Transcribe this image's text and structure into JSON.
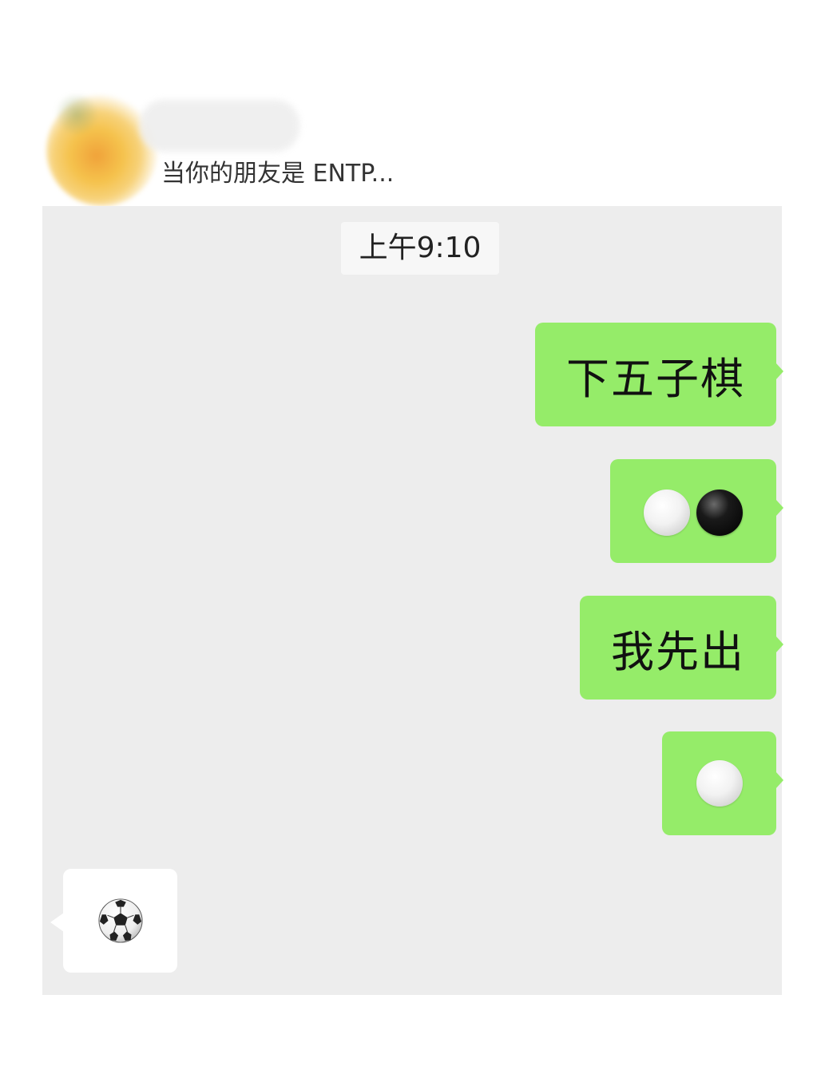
{
  "post": {
    "caption": "当你的朋友是 ENTP..."
  },
  "chat": {
    "timestamp": "上午9:10",
    "messages": [
      {
        "from": "me",
        "kind": "text",
        "text": "下五子棋"
      },
      {
        "from": "me",
        "kind": "stones",
        "stones": [
          "white",
          "black"
        ]
      },
      {
        "from": "me",
        "kind": "text",
        "text": "我先出"
      },
      {
        "from": "me",
        "kind": "stones",
        "stones": [
          "white"
        ]
      },
      {
        "from": "friend",
        "kind": "emoji",
        "icon": "soccer-ball-icon"
      }
    ]
  },
  "colors": {
    "chat_background": "#ededed",
    "sent_bubble": "#95ec69",
    "received_bubble": "#ffffff",
    "timestamp_background": "#f7f7f7"
  }
}
